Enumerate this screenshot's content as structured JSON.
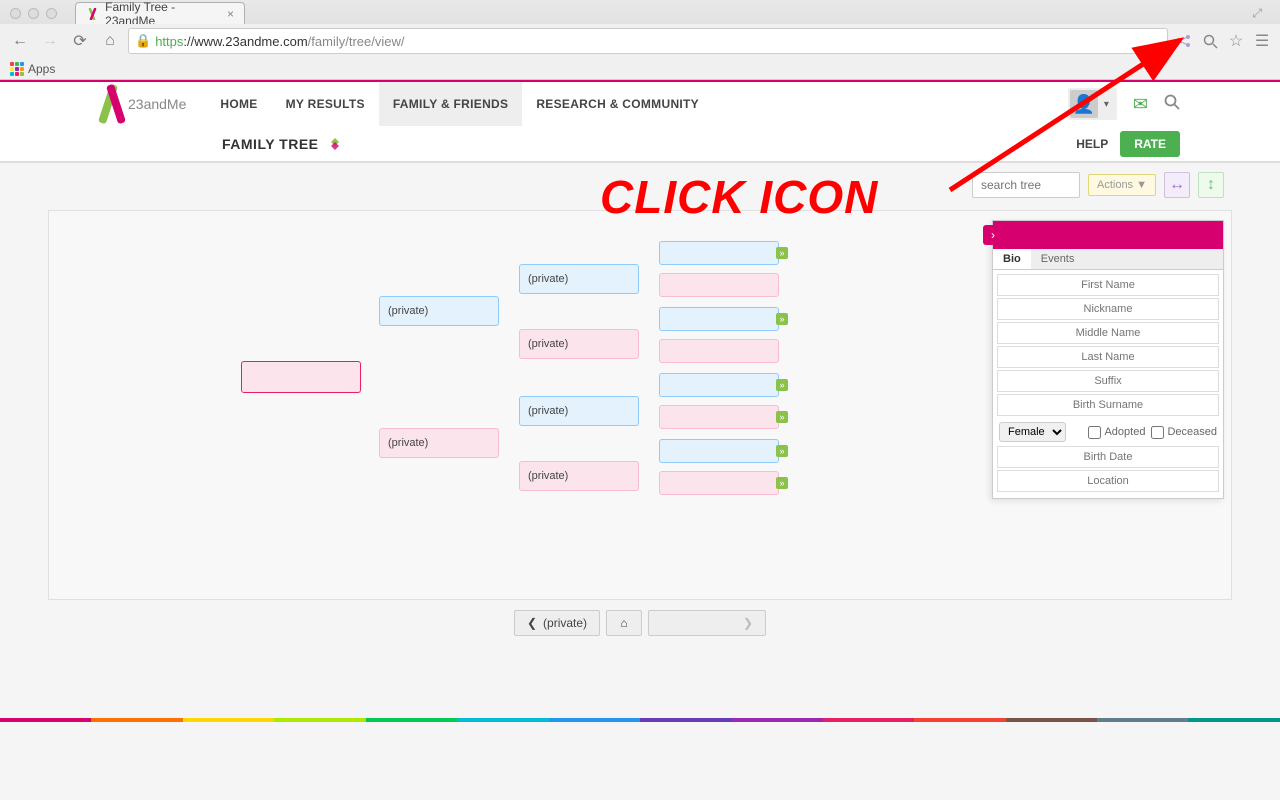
{
  "browser": {
    "tab_title": "Family Tree - 23andMe",
    "url_proto": "https",
    "url_domain": "://www.23andme.com",
    "url_path": "/family/tree/view/",
    "apps_label": "Apps"
  },
  "header": {
    "logo_text": "23andMe",
    "nav": [
      "HOME",
      "MY RESULTS",
      "FAMILY & FRIENDS",
      "RESEARCH & COMMUNITY"
    ],
    "active_nav_index": 2
  },
  "subheader": {
    "title": "FAMILY TREE",
    "help": "HELP",
    "rate": "RATE"
  },
  "toolbar": {
    "search_placeholder": "search tree",
    "actions_label": "Actions ▼"
  },
  "tree": {
    "private_label": "(private)"
  },
  "details": {
    "tabs": [
      "Bio",
      "Events"
    ],
    "active_tab": 0,
    "fields": {
      "first_name": "First Name",
      "nickname": "Nickname",
      "middle_name": "Middle Name",
      "last_name": "Last Name",
      "suffix": "Suffix",
      "birth_surname": "Birth Surname",
      "birth_date": "Birth Date",
      "location": "Location"
    },
    "gender": "Female",
    "adopted_label": "Adopted",
    "deceased_label": "Deceased"
  },
  "bottom_nav": {
    "prev_label": "(private)"
  },
  "annotation": {
    "text": "CLICK ICON"
  },
  "rainbow_colors": [
    "#d6006e",
    "#ff6f00",
    "#ffd600",
    "#aeea00",
    "#00c853",
    "#00bcd4",
    "#2196f3",
    "#673ab7",
    "#9c27b0",
    "#e91e63",
    "#f44336",
    "#795548",
    "#607d8b",
    "#009688"
  ]
}
